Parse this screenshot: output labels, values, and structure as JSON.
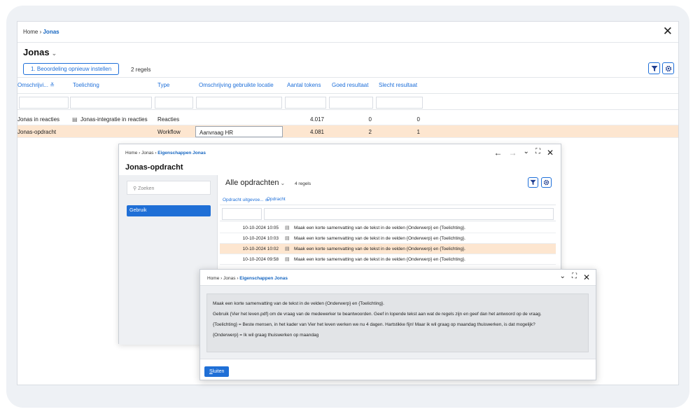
{
  "main": {
    "breadcrumb": {
      "home": "Home",
      "sep": "›",
      "current": "Jonas"
    },
    "title": "Jonas",
    "title_chevron": "⌄",
    "close_glyph": "✕",
    "toolbar": {
      "reset_button": "1. Beoordeling opnieuw instellen",
      "row_count": "2 regels"
    },
    "columns": [
      "Omschrijvi... ≚",
      "Toelichting",
      "Type",
      "Omschrijving gebruikte locatie",
      "Aantal tokens",
      "Goed resultaat",
      "Slecht resultaat"
    ],
    "rows": [
      {
        "omschrijving": "Jonas in reacties",
        "toelichting": "Jonas-integratie in reacties",
        "type": "Reacties",
        "locatie": "",
        "tokens": "4.017",
        "goed": "0",
        "slecht": "0",
        "selected": false
      },
      {
        "omschrijving": "Jonas-opdracht",
        "toelichting": "",
        "type": "Workflow",
        "locatie": "Aanvraag HR",
        "tokens": "4.081",
        "goed": "2",
        "slecht": "1",
        "selected": true
      }
    ]
  },
  "panel2": {
    "breadcrumb": {
      "home": "Home",
      "sep": "›",
      "mid": "Jonas",
      "current": "Eigenschappen Jonas"
    },
    "title": "Jonas-opdracht",
    "header_icons": [
      "arrow-left-icon",
      "arrow-right-icon",
      "chevron-down-icon",
      "expand-icon",
      "close-icon"
    ],
    "search_placeholder": "Zoeken",
    "sidebar_items": [
      "Gebruik"
    ],
    "list_title": "Alle opdrachten",
    "list_chevron": "⌄",
    "row_count": "4 regels",
    "columns": [
      "Opdracht uitgevoe... ⚌",
      "Opdracht"
    ],
    "rows": [
      {
        "date": "10-10-2024 10:05",
        "text": "Maak een korte samenvatting van de tekst in de velden {Onderwerp} en {Toelichting}.",
        "selected": false
      },
      {
        "date": "10-10-2024 10:03",
        "text": "Maak een korte samenvatting van de tekst in de velden {Onderwerp} en {Toelichting}.",
        "selected": false
      },
      {
        "date": "10-10-2024 10:02",
        "text": "Maak een korte samenvatting van de tekst in de velden {Onderwerp} en {Toelichting}.",
        "selected": true
      },
      {
        "date": "10-10-2024 09:58",
        "text": "Maak een korte samenvatting van de tekst in de velden {Onderwerp} en {Toelichting}.",
        "selected": false
      }
    ]
  },
  "panel3": {
    "breadcrumb": {
      "home": "Home",
      "sep": "›",
      "mid": "Jonas",
      "current": "Eigenschappen Jonas"
    },
    "header_icons": [
      "chevron-down-icon",
      "expand-icon",
      "close-icon"
    ],
    "lines": [
      "Maak een korte samenvatting van de tekst in de velden {Onderwerp} en {Toelichting}.",
      "Gebruik {Vier het leven.pdf} om de vraag van de medewerker te beantwoorden. Geef in lopende tekst aan wat de regels zijn en geef dan het antwoord op de vraag.",
      "{Toelichting} = Beste mensen, in het kader van Vier het leven werken we nu 4 dagen. Hartstikke fijn! Maar ik wil graag op maandag thuiswerken, is dat mogelijk?",
      "{Onderwerp} = Ik wil graag thuiswerken op maandag"
    ],
    "close_button_first": "S",
    "close_button_rest": "luiten"
  },
  "colors": {
    "accent": "#1e6fd9",
    "selected_row": "#fde6d0",
    "frame": "#eef1f5"
  }
}
